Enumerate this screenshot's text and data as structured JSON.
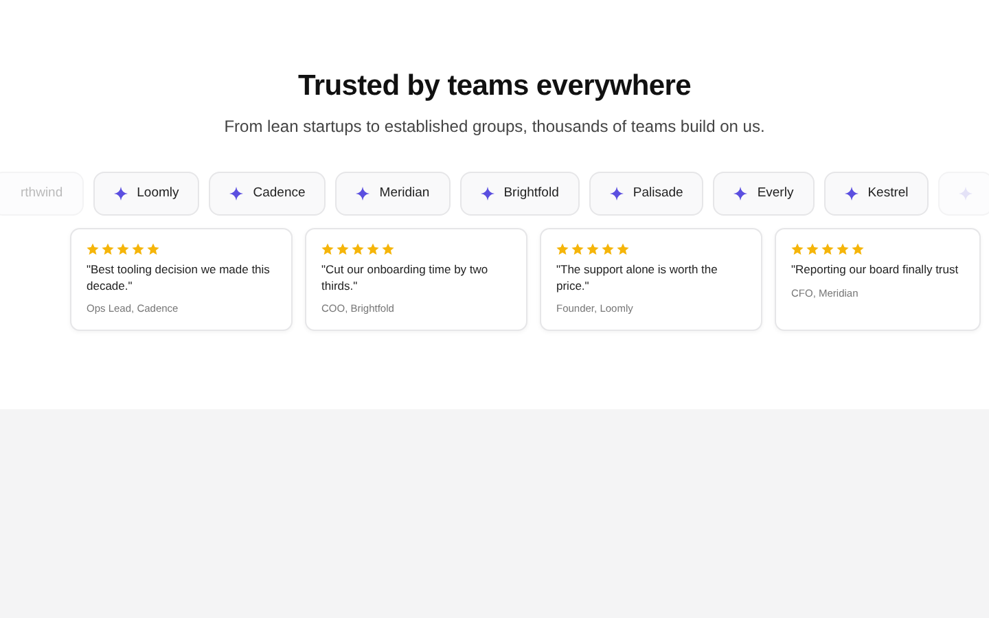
{
  "heading": "Trusted by teams everywhere",
  "subheading": "From lean startups to established groups, thousands of teams build on us.",
  "logos": [
    {
      "kind": "text",
      "name": "rthwind",
      "faded": true
    },
    {
      "kind": "sparkle",
      "name": "Loomly",
      "faded": false
    },
    {
      "kind": "sparkle",
      "name": "Cadence",
      "faded": false
    },
    {
      "kind": "sparkle",
      "name": "Meridian",
      "faded": false
    },
    {
      "kind": "sparkle",
      "name": "Brightfold",
      "faded": false
    },
    {
      "kind": "sparkle",
      "name": "Palisade",
      "faded": false
    },
    {
      "kind": "sparkle",
      "name": "Everly",
      "faded": false
    },
    {
      "kind": "sparkle",
      "name": "Kestrel",
      "faded": false
    },
    {
      "kind": "sparkle-only",
      "faded": true
    }
  ],
  "testimonials": [
    {
      "stars": 5,
      "quote": "\"Best tooling decision we made this decade.\"",
      "author": "Ops Lead, Cadence"
    },
    {
      "stars": 5,
      "quote": "\"Cut our onboarding time by two thirds.\"",
      "author": "COO, Brightfold"
    },
    {
      "stars": 5,
      "quote": "\"The support alone is worth the price.\"",
      "author": "Founder, Loomly"
    },
    {
      "stars": 5,
      "quote": "\"Reporting our board finally trust",
      "author": "CFO, Meridian"
    }
  ]
}
